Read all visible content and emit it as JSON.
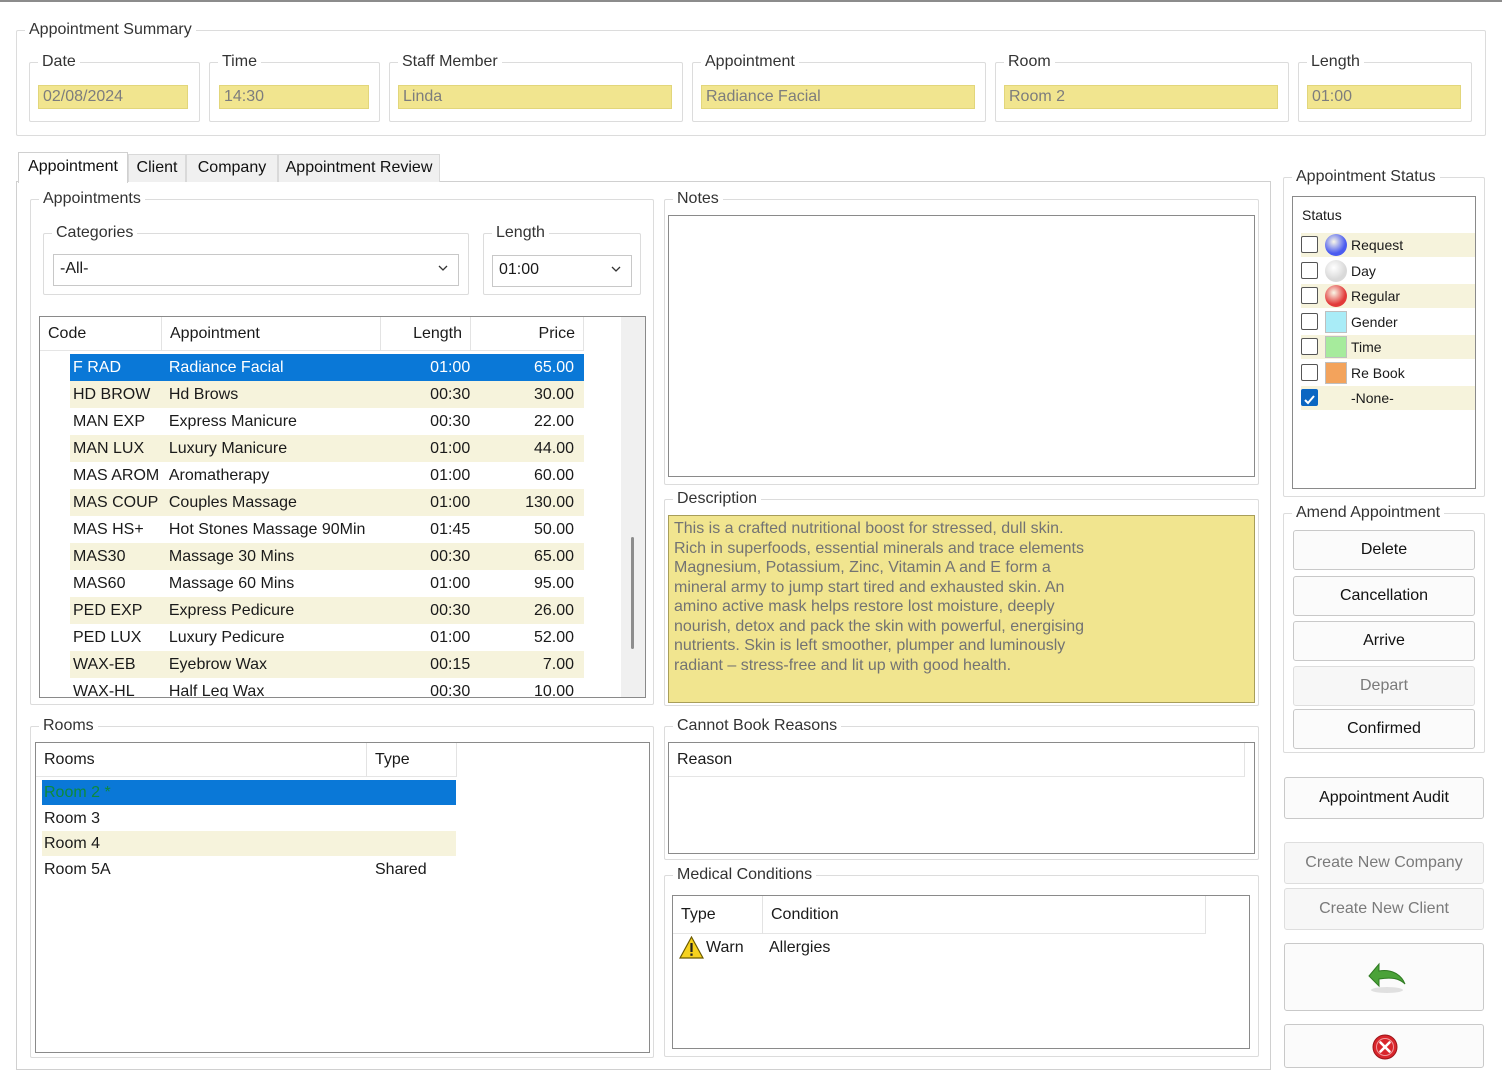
{
  "summary": {
    "legend": "Appointment Summary",
    "date_label": "Date",
    "date": "02/08/2024",
    "time_label": "Time",
    "time": "14:30",
    "staff_label": "Staff Member",
    "staff": "Linda",
    "appointment_label": "Appointment",
    "appointment": "Radiance Facial",
    "room_label": "Room",
    "room": "Room 2",
    "length_label": "Length",
    "length": "01:00"
  },
  "tabs": [
    {
      "label": "Appointment",
      "active": true
    },
    {
      "label": "Client"
    },
    {
      "label": "Company"
    },
    {
      "label": "Appointment Review"
    }
  ],
  "appointments": {
    "legend": "Appointments",
    "categories_label": "Categories",
    "categories_value": "-All-",
    "length_label": "Length",
    "length_value": "01:00",
    "columns": [
      "Code",
      "Appointment",
      "Length",
      "Price"
    ],
    "rows": [
      {
        "code": "F RAD",
        "name": "Radiance Facial",
        "length": "01:00",
        "price": "65.00",
        "selected": true
      },
      {
        "code": "HD BROW",
        "name": "Hd Brows",
        "length": "00:30",
        "price": "30.00"
      },
      {
        "code": "MAN EXP",
        "name": "Express Manicure",
        "length": "00:30",
        "price": "22.00"
      },
      {
        "code": "MAN LUX",
        "name": "Luxury Manicure",
        "length": "01:00",
        "price": "44.00"
      },
      {
        "code": "MAS AROM",
        "name": "Aromatherapy",
        "length": "01:00",
        "price": "60.00"
      },
      {
        "code": "MAS COUP",
        "name": "Couples Massage",
        "length": "01:00",
        "price": "130.00"
      },
      {
        "code": "MAS HS+",
        "name": "Hot Stones Massage 90Min",
        "length": "01:45",
        "price": "50.00"
      },
      {
        "code": "MAS30",
        "name": "Massage 30 Mins",
        "length": "00:30",
        "price": "65.00"
      },
      {
        "code": "MAS60",
        "name": "Massage 60 Mins",
        "length": "01:00",
        "price": "95.00"
      },
      {
        "code": "PED EXP",
        "name": "Express Pedicure",
        "length": "00:30",
        "price": "26.00"
      },
      {
        "code": "PED LUX",
        "name": "Luxury Pedicure",
        "length": "01:00",
        "price": "52.00"
      },
      {
        "code": "WAX-EB",
        "name": "Eyebrow Wax",
        "length": "00:15",
        "price": "7.00"
      },
      {
        "code": "WAX-HL",
        "name": "Half Leg Wax",
        "length": "00:30",
        "price": "10.00"
      }
    ]
  },
  "notes": {
    "legend": "Notes",
    "text": ""
  },
  "description": {
    "legend": "Description",
    "lines": [
      "This is a crafted nutritional boost for stressed, dull skin.",
      "Rich in superfoods, essential minerals and trace elements",
      "Magnesium, Potassium, Zinc, Vitamin A and E form a",
      "mineral army to jump start tired and exhausted skin. An",
      "amino active mask helps restore lost moisture, deeply",
      "nourish, detox and pack the skin with powerful, energising",
      "nutrients. Skin is left smoother, plumper and luminously",
      "radiant – stress-free and lit up with good health."
    ]
  },
  "rooms": {
    "legend": "Rooms",
    "columns": [
      "Rooms",
      "Type"
    ],
    "rows": [
      {
        "room": "Room 2 *",
        "type": "",
        "selected": true
      },
      {
        "room": "Room 3",
        "type": ""
      },
      {
        "room": "Room 4",
        "type": ""
      },
      {
        "room": "Room 5A",
        "type": "Shared"
      }
    ]
  },
  "cannot_book": {
    "legend": "Cannot Book Reasons",
    "columns": [
      "Reason"
    ]
  },
  "medical": {
    "legend": "Medical Conditions",
    "columns": [
      "Type",
      "Condition"
    ],
    "rows": [
      {
        "type": "Warn",
        "condition": "Allergies",
        "icon": "warning-icon"
      }
    ]
  },
  "status": {
    "legend": "Appointment Status",
    "header": "Status",
    "items": [
      {
        "label": "Request",
        "color": "#4b5cf0",
        "shape": "circle",
        "checked": false
      },
      {
        "label": "Day",
        "color": "#d9d9d9",
        "shape": "circle",
        "checked": false
      },
      {
        "label": "Regular",
        "color": "#e23a3a",
        "shape": "circle",
        "checked": false
      },
      {
        "label": "Gender",
        "color": "#a9ecf7",
        "shape": "square",
        "checked": false
      },
      {
        "label": "Time",
        "color": "#a6eb9c",
        "shape": "square",
        "checked": false
      },
      {
        "label": "Re Book",
        "color": "#f3a35c",
        "shape": "square",
        "checked": false
      },
      {
        "label": "-None-",
        "color": "",
        "shape": "none",
        "checked": true
      }
    ]
  },
  "amend": {
    "legend": "Amend Appointment",
    "delete": "Delete",
    "cancellation": "Cancellation",
    "arrive": "Arrive",
    "depart": "Depart",
    "confirmed": "Confirmed"
  },
  "actions": {
    "audit": "Appointment Audit",
    "create_company": "Create New Company",
    "create_client": "Create New Client",
    "undo_icon": "undo-arrow-icon",
    "close_icon": "close-circle-icon"
  }
}
